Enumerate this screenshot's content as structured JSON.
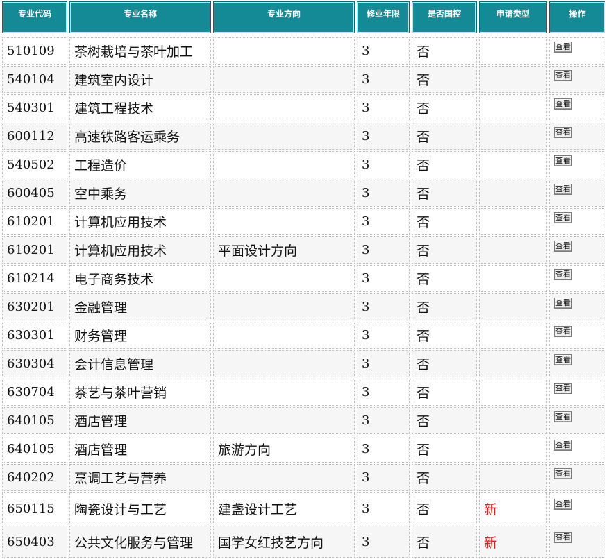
{
  "headers": [
    "专业代码",
    "专业名称",
    "专业方向",
    "修业年限",
    "是否国控",
    "申请类型",
    "操作"
  ],
  "view_label": "查看",
  "rows": [
    {
      "code": "510109",
      "name": "茶树栽培与茶叶加工",
      "direction": "",
      "years": "3",
      "controlled": "否",
      "type": ""
    },
    {
      "code": "540104",
      "name": "建筑室内设计",
      "direction": "",
      "years": "3",
      "controlled": "否",
      "type": ""
    },
    {
      "code": "540301",
      "name": "建筑工程技术",
      "direction": "",
      "years": "3",
      "controlled": "否",
      "type": ""
    },
    {
      "code": "600112",
      "name": "高速铁路客运乘务",
      "direction": "",
      "years": "3",
      "controlled": "否",
      "type": ""
    },
    {
      "code": "540502",
      "name": "工程造价",
      "direction": "",
      "years": "3",
      "controlled": "否",
      "type": ""
    },
    {
      "code": "600405",
      "name": "空中乘务",
      "direction": "",
      "years": "3",
      "controlled": "否",
      "type": ""
    },
    {
      "code": "610201",
      "name": "计算机应用技术",
      "direction": "",
      "years": "3",
      "controlled": "否",
      "type": ""
    },
    {
      "code": "610201",
      "name": "计算机应用技术",
      "direction": "平面设计方向",
      "years": "3",
      "controlled": "否",
      "type": ""
    },
    {
      "code": "610214",
      "name": "电子商务技术",
      "direction": "",
      "years": "3",
      "controlled": "否",
      "type": ""
    },
    {
      "code": "630201",
      "name": "金融管理",
      "direction": "",
      "years": "3",
      "controlled": "否",
      "type": ""
    },
    {
      "code": "630301",
      "name": "财务管理",
      "direction": "",
      "years": "3",
      "controlled": "否",
      "type": ""
    },
    {
      "code": "630304",
      "name": "会计信息管理",
      "direction": "",
      "years": "3",
      "controlled": "否",
      "type": ""
    },
    {
      "code": "630704",
      "name": "茶艺与茶叶营销",
      "direction": "",
      "years": "3",
      "controlled": "否",
      "type": ""
    },
    {
      "code": "640105",
      "name": "酒店管理",
      "direction": "",
      "years": "3",
      "controlled": "否",
      "type": ""
    },
    {
      "code": "640105",
      "name": "酒店管理",
      "direction": "旅游方向",
      "years": "3",
      "controlled": "否",
      "type": ""
    },
    {
      "code": "640202",
      "name": "烹调工艺与营养",
      "direction": "",
      "years": "3",
      "controlled": "否",
      "type": ""
    },
    {
      "code": "650115",
      "name": "陶瓷设计与工艺",
      "direction": "建盏设计工艺",
      "years": "3",
      "controlled": "否",
      "type": "新"
    },
    {
      "code": "650403",
      "name": "公共文化服务与管理",
      "direction": "国学女红技艺方向",
      "years": "3",
      "controlled": "否",
      "type": "新"
    }
  ]
}
